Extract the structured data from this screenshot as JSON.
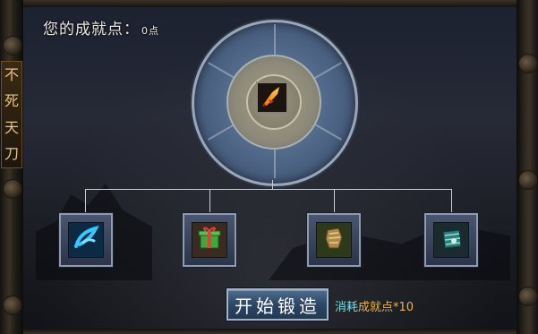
{
  "header": {
    "title": "您的成就点：",
    "points_value": "0点"
  },
  "side_tab": {
    "chars": [
      "不",
      "死",
      "天",
      "刀"
    ]
  },
  "center_item": {
    "icon": "flaming-blade-icon"
  },
  "material_slots": [
    {
      "icon": "blue-feather-icon"
    },
    {
      "icon": "green-gift-box-icon"
    },
    {
      "icon": "bronze-gauntlet-icon"
    },
    {
      "icon": "jade-armor-icon"
    }
  ],
  "forge": {
    "button_label": "开始锻造",
    "cost_prefix": "消耗",
    "cost_text": "成就点*10"
  },
  "colors": {
    "cost_prefix": "#6fe0e8",
    "cost_text": "#e7b24a",
    "button": "#2d4663"
  }
}
